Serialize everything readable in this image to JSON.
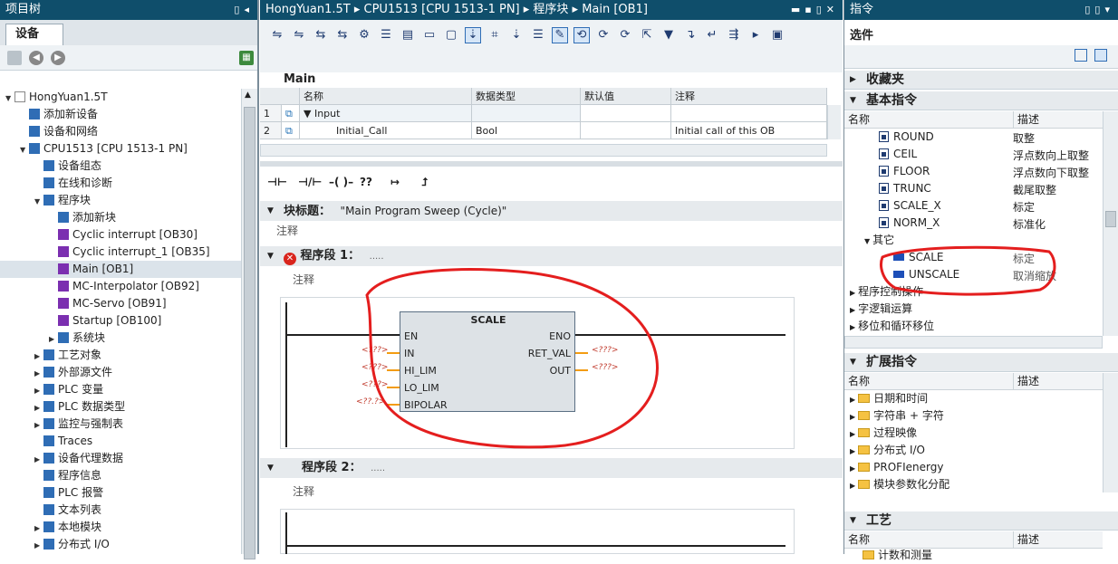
{
  "left_panel": {
    "title": "项目树",
    "tab": "设备",
    "tree": [
      {
        "label": "HongYuan1.5T",
        "indent": 0,
        "arrow": "▼",
        "icon": "project-icon"
      },
      {
        "label": "添加新设备",
        "indent": 1,
        "arrow": "",
        "icon": "add-device-icon"
      },
      {
        "label": "设备和网络",
        "indent": 1,
        "arrow": "",
        "icon": "network-icon"
      },
      {
        "label": "CPU1513 [CPU 1513-1 PN]",
        "indent": 1,
        "arrow": "▼",
        "icon": "cpu-icon"
      },
      {
        "label": "设备组态",
        "indent": 2,
        "arrow": "",
        "icon": "config-icon"
      },
      {
        "label": "在线和诊断",
        "indent": 2,
        "arrow": "",
        "icon": "online-icon"
      },
      {
        "label": "程序块",
        "indent": 2,
        "arrow": "▼",
        "icon": "program-blocks-icon"
      },
      {
        "label": "添加新块",
        "indent": 3,
        "arrow": "",
        "icon": "add-block-icon"
      },
      {
        "label": "Cyclic interrupt [OB30]",
        "indent": 3,
        "arrow": "",
        "icon": "ob-icon"
      },
      {
        "label": "Cyclic interrupt_1 [OB35]",
        "indent": 3,
        "arrow": "",
        "icon": "ob-icon"
      },
      {
        "label": "Main [OB1]",
        "indent": 3,
        "arrow": "",
        "icon": "ob-icon",
        "selected": true
      },
      {
        "label": "MC-Interpolator [OB92]",
        "indent": 3,
        "arrow": "",
        "icon": "ob-icon"
      },
      {
        "label": "MC-Servo [OB91]",
        "indent": 3,
        "arrow": "",
        "icon": "ob-icon"
      },
      {
        "label": "Startup [OB100]",
        "indent": 3,
        "arrow": "",
        "icon": "ob-icon"
      },
      {
        "label": "系统块",
        "indent": 3,
        "arrow": "▶",
        "icon": "system-blocks-icon"
      },
      {
        "label": "工艺对象",
        "indent": 2,
        "arrow": "▶",
        "icon": "tech-object-icon"
      },
      {
        "label": "外部源文件",
        "indent": 2,
        "arrow": "▶",
        "icon": "source-file-icon"
      },
      {
        "label": "PLC 变量",
        "indent": 2,
        "arrow": "▶",
        "icon": "plc-tags-icon"
      },
      {
        "label": "PLC 数据类型",
        "indent": 2,
        "arrow": "▶",
        "icon": "data-type-icon"
      },
      {
        "label": "监控与强制表",
        "indent": 2,
        "arrow": "▶",
        "icon": "watch-table-icon"
      },
      {
        "label": "Traces",
        "indent": 2,
        "arrow": "",
        "icon": "traces-icon"
      },
      {
        "label": "设备代理数据",
        "indent": 2,
        "arrow": "▶",
        "icon": "proxy-icon"
      },
      {
        "label": "程序信息",
        "indent": 2,
        "arrow": "",
        "icon": "program-info-icon"
      },
      {
        "label": "PLC 报警",
        "indent": 2,
        "arrow": "",
        "icon": "alarm-icon"
      },
      {
        "label": "文本列表",
        "indent": 2,
        "arrow": "",
        "icon": "text-list-icon"
      },
      {
        "label": "本地模块",
        "indent": 2,
        "arrow": "▶",
        "icon": "local-module-icon"
      },
      {
        "label": "分布式 I/O",
        "indent": 2,
        "arrow": "▶",
        "icon": "distributed-io-icon"
      }
    ]
  },
  "editor": {
    "title": "HongYuan1.5T ▸ CPU1513 [CPU 1513-1 PN] ▸ 程序块 ▸ Main [OB1]",
    "block_name": "Main",
    "table_headers": [
      "名称",
      "数据类型",
      "默认值",
      "注释"
    ],
    "rows": [
      {
        "num": "1",
        "name": "Input",
        "type": "",
        "default": "",
        "comment": ""
      },
      {
        "num": "2",
        "name": "Initial_Call",
        "type": "Bool",
        "default": "",
        "comment": "Initial call of this OB"
      }
    ],
    "block_title_label": "块标题：",
    "block_title_value": "\"Main Program Sweep (Cycle)\"",
    "block_comment": "注释",
    "network1_label": "程序段 1：",
    "network1_dots": ".....",
    "network1_comment": "注释",
    "network2_label": "程序段 2：",
    "network2_dots": ".....",
    "network2_comment": "注释",
    "scale_block": {
      "name": "SCALE",
      "inputs": [
        "EN",
        "IN",
        "HI_LIM",
        "LO_LIM",
        "BIPOLAR"
      ],
      "outputs": [
        "ENO",
        "RET_VAL",
        "OUT"
      ],
      "placeholder": "<???>",
      "placeholder_bool": "<??.?>"
    },
    "lad_buttons": [
      "⊣⊢",
      "⊣/⊢",
      "–( )–",
      "??",
      "↦",
      "⮥"
    ]
  },
  "right_panel": {
    "title": "指令",
    "options_label": "选件",
    "favorites": "收藏夹",
    "basic": "基本指令",
    "col_name": "名称",
    "col_desc": "描述",
    "basic_items": [
      {
        "label": "ROUND",
        "desc": "取整",
        "kind": "fn",
        "indent": 1
      },
      {
        "label": "CEIL",
        "desc": "浮点数向上取整",
        "kind": "fn",
        "indent": 1
      },
      {
        "label": "FLOOR",
        "desc": "浮点数向下取整",
        "kind": "fn",
        "indent": 1
      },
      {
        "label": "TRUNC",
        "desc": "截尾取整",
        "kind": "fn",
        "indent": 1
      },
      {
        "label": "SCALE_X",
        "desc": "标定",
        "kind": "fn",
        "indent": 1
      },
      {
        "label": "NORM_X",
        "desc": "标准化",
        "kind": "fn",
        "indent": 1
      },
      {
        "label": "其它",
        "desc": "",
        "kind": "folder",
        "indent": 0,
        "arrow": "▼"
      },
      {
        "label": "SCALE",
        "desc": "标定",
        "kind": "blue",
        "indent": 2
      },
      {
        "label": "UNSCALE",
        "desc": "取消缩放",
        "kind": "blue",
        "indent": 2
      },
      {
        "label": "程序控制操作",
        "desc": "",
        "kind": "folder",
        "indent": -1,
        "arrow": "▶"
      },
      {
        "label": "字逻辑运算",
        "desc": "",
        "kind": "folder",
        "indent": -1,
        "arrow": "▶"
      },
      {
        "label": "移位和循环移位",
        "desc": "",
        "kind": "folder",
        "indent": -1,
        "arrow": "▶"
      }
    ],
    "extended": "扩展指令",
    "extended_items": [
      {
        "label": "日期和时间"
      },
      {
        "label": "字符串 + 字符"
      },
      {
        "label": "过程映像"
      },
      {
        "label": "分布式 I/O"
      },
      {
        "label": "PROFIenergy"
      },
      {
        "label": "模块参数化分配"
      }
    ],
    "tech": "工艺",
    "tech_item": "计数和测量"
  },
  "colors": {
    "titlebar": "#0f4e6b",
    "annotation": "#e41e1e",
    "error": "#d9251d"
  }
}
